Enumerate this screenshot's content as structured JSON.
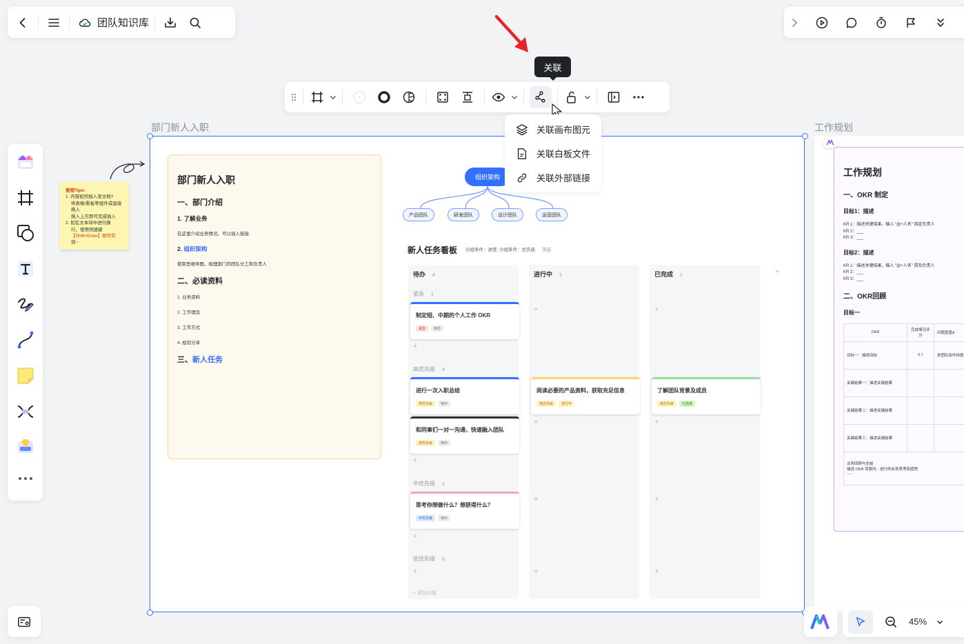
{
  "topbar": {
    "title": "团队知识库"
  },
  "tooltip": {
    "text": "关联"
  },
  "dropdown": {
    "items": [
      "关联画布图元",
      "关联白板文件",
      "关联外部链接"
    ]
  },
  "frames": {
    "frame1_label": "部门新人入职",
    "frame2_label": "工作规划"
  },
  "sticky": {
    "title": "使用Tips:",
    "lines": [
      "1. 内容如何插入至文档?",
      "将表格/看板等组件或直接拖入",
      "拖入上方即可完成插入",
      "2. 如在文本块中进行换",
      "行，使用快捷键",
      "【Shift+Enter】即可实",
      "现~"
    ]
  },
  "doc": {
    "title": "部门新人入职",
    "s1": "一、部门介绍",
    "s1_1": "1. 了解业务",
    "s1_1_p": "在这里介绍业务情况，可以插入链接",
    "s1_2_prefix": "2. ",
    "s1_2_link": "组织架构",
    "s1_2_p": "使用思维导图，梳理部门的团队分工和负责人",
    "s2": "二、必读资料",
    "s2_items": [
      "1. 业务资料",
      "2. 工作理念",
      "3. 工作方式",
      "4. 经验分享"
    ],
    "s3_prefix": "三、",
    "s3_link": "新人任务"
  },
  "mindmap": {
    "root": "组织架构",
    "nodes": [
      "产品团队",
      "研发团队",
      "设计团队",
      "运营团队"
    ]
  },
  "kanban": {
    "title": "新人任务看板",
    "meta": "分组条件：进度; 分组条件：优先级",
    "filter": "筛选",
    "columns": [
      {
        "name": "待办",
        "count": "4"
      },
      {
        "name": "进行中",
        "count": "1"
      },
      {
        "name": "已完成",
        "count": "1"
      }
    ],
    "groups": {
      "urgent": {
        "name": "紧急",
        "count": "1"
      },
      "high": {
        "name": "高优先级",
        "count": "4"
      },
      "mid": {
        "name": "中优先级",
        "count": "1"
      },
      "low": {
        "name": "低优先级",
        "count": "0"
      }
    },
    "cards": {
      "c1": {
        "title": "制定短、中期的个人工作 OKR",
        "tag1": "紧急",
        "tag2": "待办"
      },
      "c2": {
        "title": "进行一次入职总结",
        "tag1": "高优先级",
        "tag2": "待办"
      },
      "c3": {
        "title": "和同事们一对一沟通，快速融入团队",
        "tag1": "高优先级",
        "tag2": "待办"
      },
      "c4": {
        "title": "思考你想做什么？想获得什么？",
        "tag1": "中优先级",
        "tag2": "待办"
      },
      "c5": {
        "title": "阅读必要的产品资料，获取充足信息",
        "tag1": "高优先级",
        "tag2": "进行中"
      },
      "c6": {
        "title": "了解团队背景及成员",
        "tag1": "高优先级",
        "tag2": "已完成"
      }
    },
    "add_group": "+ 添加分组"
  },
  "okr": {
    "title": "工作规划",
    "s1": "一、OKR 制定",
    "g1": "目标1：描述",
    "g1_p": "KR 1：描述关键结果，输入 \"@+人名\" 指定负责人\nKR 2：___\nKR 3：___",
    "g2": "目标2：描述",
    "g2_p": "KR 1：描述关键结果，输入 \"@+人名\" 提及负责人\nKR 2：___\nKR 3：___",
    "s2": "二、OKR回顾",
    "g3": "目标一",
    "table": {
      "h1": "OKR",
      "h2": "完成情况评分",
      "h3": "问题复盘&",
      "r1c1": "目标一：描述目标",
      "r1c2": "0.7",
      "r1c3": "多团队协作待提高",
      "r2c1": "关键结果一：描述关键结果",
      "r3c1": "关键结果二：描述关键结果",
      "r4c1": "关键结果三：描述关键结果",
      "r5c1": "业务回顾与总结\n描述 OKR 背景内，进行的业务思考和感悟\n......"
    }
  },
  "zoom": {
    "value": "45%"
  }
}
